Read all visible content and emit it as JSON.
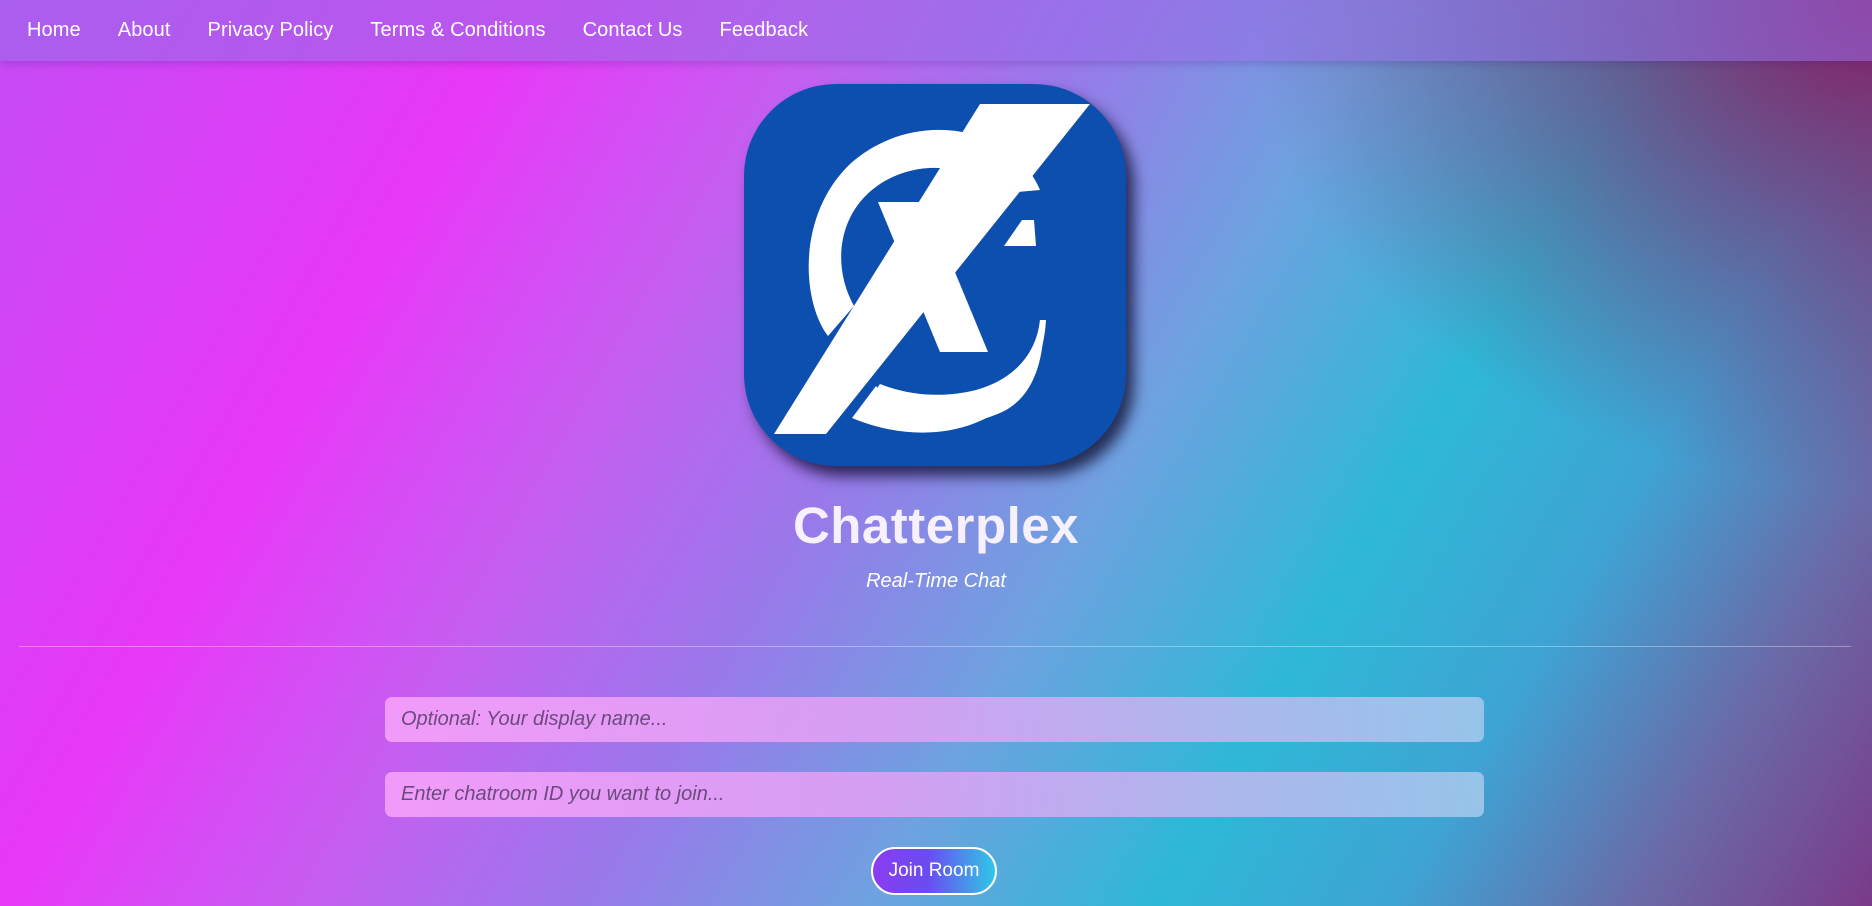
{
  "nav": {
    "items": [
      {
        "label": "Home"
      },
      {
        "label": "About"
      },
      {
        "label": "Privacy Policy"
      },
      {
        "label": "Terms & Conditions"
      },
      {
        "label": "Contact Us"
      },
      {
        "label": "Feedback"
      }
    ]
  },
  "logo": {
    "icon": "chatterplex-cx-logo",
    "background_color": "#0d4fae",
    "glyph_color": "#ffffff"
  },
  "hero": {
    "title": "Chatterplex",
    "subtitle": "Real-Time Chat"
  },
  "form": {
    "display_name": {
      "value": "",
      "placeholder": "Optional: Your display name..."
    },
    "room_id": {
      "value": "",
      "placeholder": "Enter chatroom ID you want to join..."
    },
    "join_label": "Join Room"
  },
  "colors": {
    "magenta": "#e838f8",
    "cyan": "#2eb8d6",
    "corner": "#7a1a6a"
  }
}
